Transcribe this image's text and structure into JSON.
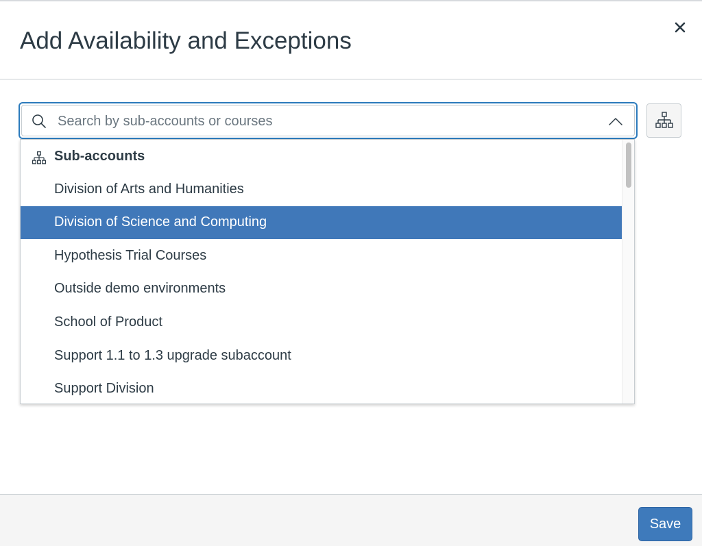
{
  "modal": {
    "title": "Add Availability and Exceptions",
    "close_icon": "close-icon"
  },
  "search": {
    "placeholder": "Search by sub-accounts or courses",
    "value": "",
    "icon": "search-icon",
    "toggle_icon": "chevron-up-icon"
  },
  "tree_button": {
    "icon": "hierarchy-icon"
  },
  "dropdown": {
    "group": {
      "label": "Sub-accounts",
      "icon": "hierarchy-icon"
    },
    "options": [
      {
        "label": "Division of Arts and Humanities",
        "selected": false
      },
      {
        "label": "Division of Science and Computing",
        "selected": true
      },
      {
        "label": "Hypothesis Trial Courses",
        "selected": false
      },
      {
        "label": "Outside demo environments",
        "selected": false
      },
      {
        "label": "School of Product",
        "selected": false
      },
      {
        "label": "Support 1.1 to 1.3 upgrade subaccount",
        "selected": false
      },
      {
        "label": "Support Division",
        "selected": false
      }
    ]
  },
  "footer": {
    "save_label": "Save"
  },
  "colors": {
    "accent": "#3e7abb",
    "selected_row": "#4078b9",
    "focus_ring": "#2b7abc",
    "text": "#2d3b45"
  }
}
